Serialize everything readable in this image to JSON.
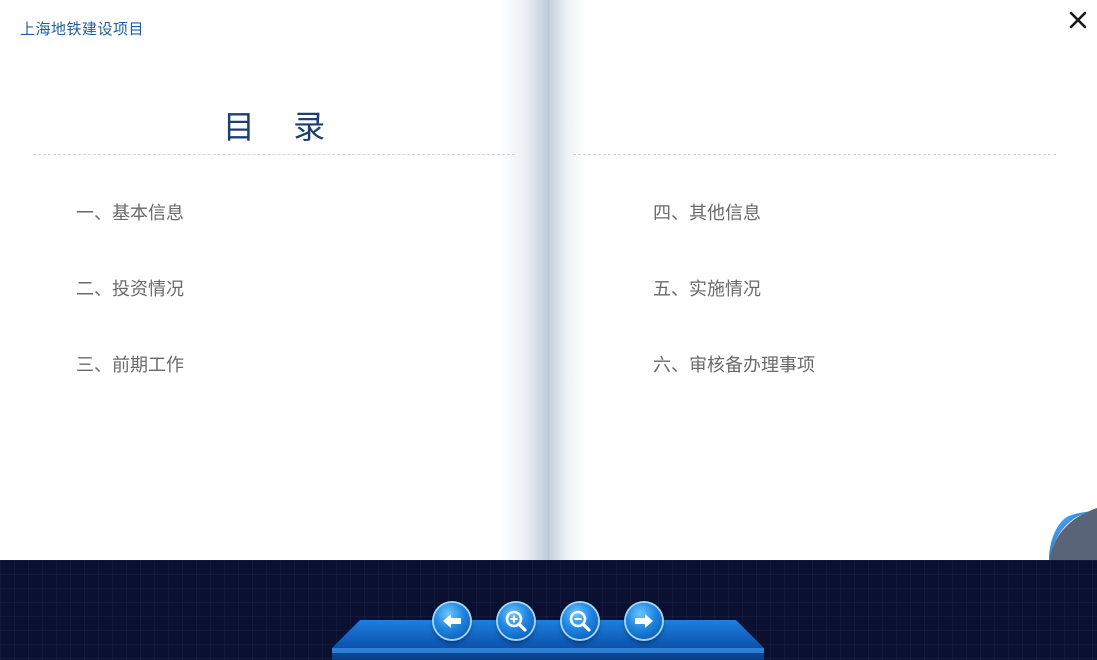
{
  "document": {
    "title": "上海地铁建设项目"
  },
  "toc": {
    "heading": "目 录",
    "left_items": [
      {
        "label": "一、基本信息"
      },
      {
        "label": "二、投资情况"
      },
      {
        "label": "三、前期工作"
      }
    ],
    "right_items": [
      {
        "label": "四、其他信息"
      },
      {
        "label": "五、实施情况"
      },
      {
        "label": "六、审核备办理事项"
      }
    ]
  },
  "icons": {
    "close": "close-icon",
    "prev": "arrow-left-icon",
    "zoom_in": "zoom-in-icon",
    "zoom_out": "zoom-out-icon",
    "next": "arrow-right-icon",
    "page_curl": "page-curl-icon"
  },
  "colors": {
    "title_blue": "#1e5fa6",
    "heading_navy": "#1d3f6e",
    "toolbar_bg": "#0b1030",
    "button_blue": "#1f86e0"
  }
}
